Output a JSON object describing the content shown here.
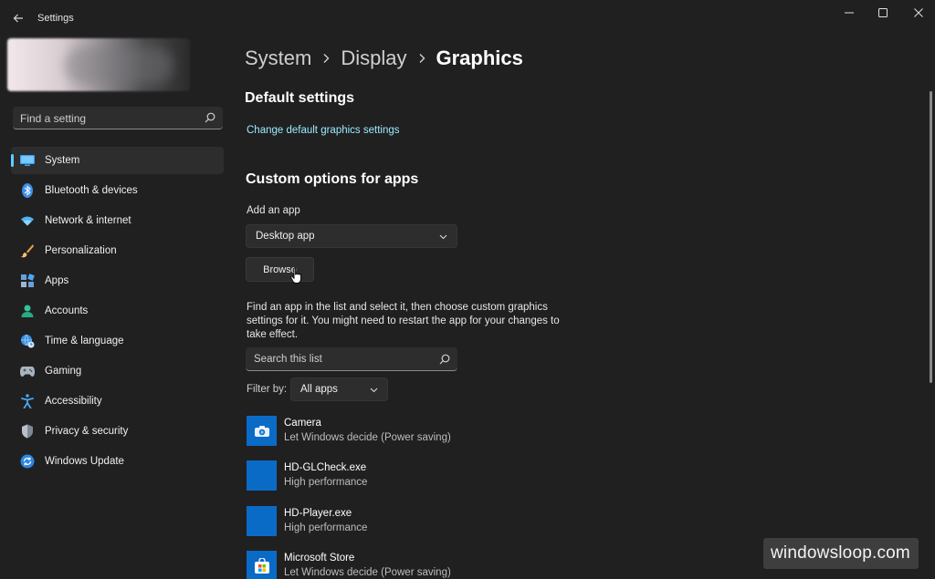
{
  "window": {
    "title": "Settings",
    "controls": [
      "minimize-icon",
      "maximize-icon",
      "close-icon"
    ]
  },
  "sidebar": {
    "search_placeholder": "Find a setting",
    "items": [
      {
        "label": "System",
        "icon": "system-icon",
        "selected": true
      },
      {
        "label": "Bluetooth & devices",
        "icon": "bluetooth-icon"
      },
      {
        "label": "Network & internet",
        "icon": "wifi-icon"
      },
      {
        "label": "Personalization",
        "icon": "brush-icon"
      },
      {
        "label": "Apps",
        "icon": "apps-icon"
      },
      {
        "label": "Accounts",
        "icon": "person-icon"
      },
      {
        "label": "Time & language",
        "icon": "globe-clock-icon"
      },
      {
        "label": "Gaming",
        "icon": "gamepad-icon"
      },
      {
        "label": "Accessibility",
        "icon": "accessibility-icon"
      },
      {
        "label": "Privacy & security",
        "icon": "shield-icon"
      },
      {
        "label": "Windows Update",
        "icon": "refresh-icon"
      }
    ]
  },
  "breadcrumb": {
    "items": [
      "System",
      "Display",
      "Graphics"
    ]
  },
  "default_settings": {
    "heading": "Default settings",
    "link": "Change default graphics settings"
  },
  "custom_options": {
    "heading": "Custom options for apps",
    "add_app_label": "Add an app",
    "add_app_selected": "Desktop app",
    "browse_label": "Browse",
    "description": "Find an app in the list and select it, then choose custom graphics settings for it. You might need to restart the app for your changes to take effect.",
    "list_search_placeholder": "Search this list",
    "filter_label": "Filter by:",
    "filter_selected": "All apps"
  },
  "apps": [
    {
      "name": "Camera",
      "setting": "Let Windows decide (Power saving)",
      "icon": "camera-icon"
    },
    {
      "name": "HD-GLCheck.exe",
      "setting": "High performance",
      "icon": "app-tile-icon"
    },
    {
      "name": "HD-Player.exe",
      "setting": "High performance",
      "icon": "app-tile-icon"
    },
    {
      "name": "Microsoft Store",
      "setting": "Let Windows decide (Power saving)",
      "icon": "store-icon"
    }
  ],
  "watermark": "windowsloop.com",
  "colors": {
    "accent": "#60cdff",
    "link": "#99ebff",
    "background": "#202020",
    "tile": "#0a6bc7"
  }
}
